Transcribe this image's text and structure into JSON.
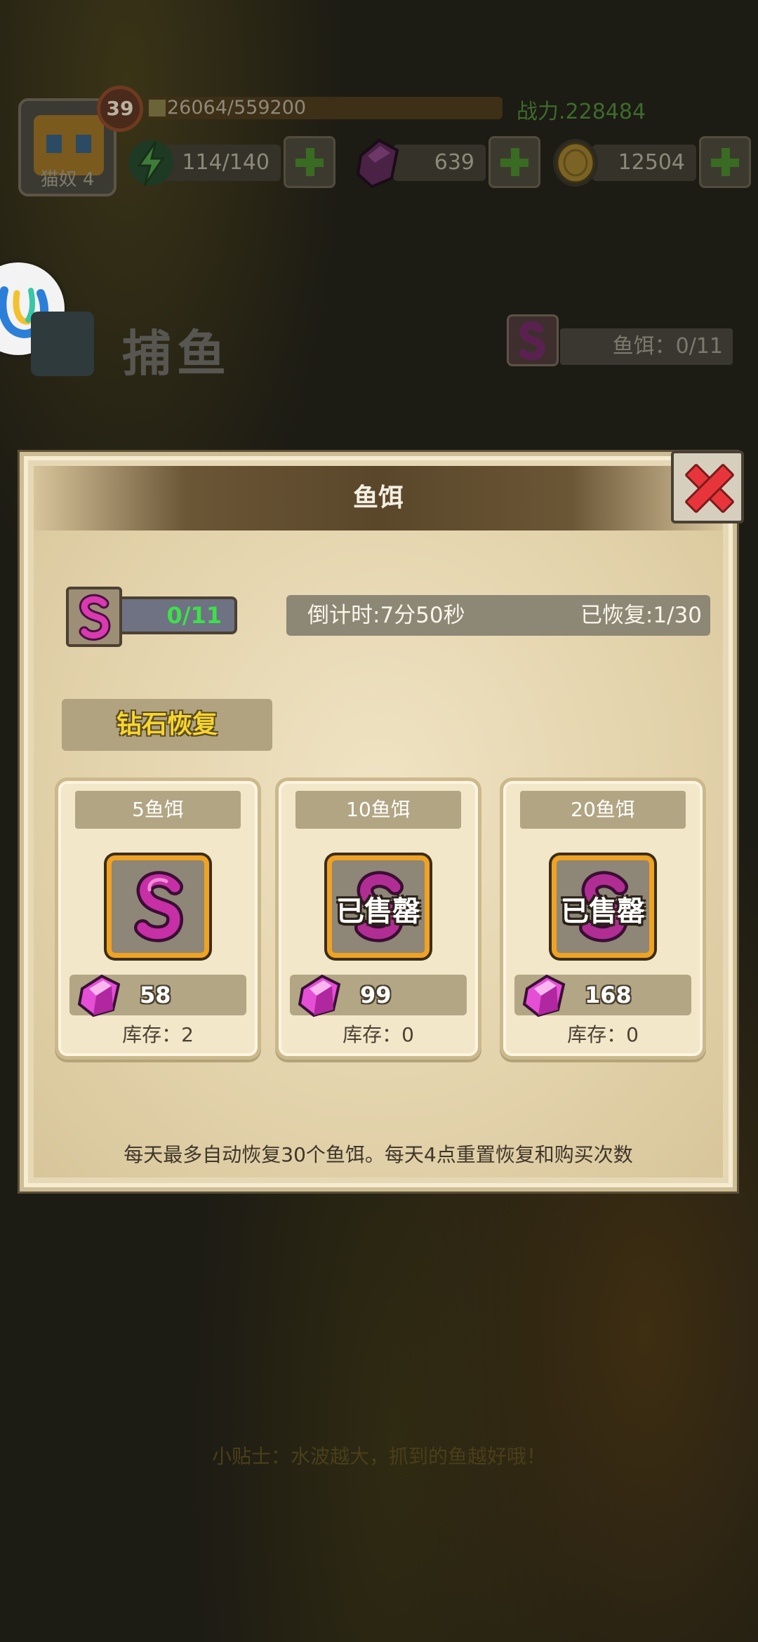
{
  "hud": {
    "player_name": "猫奴 4",
    "level": "39",
    "xp_text": "26064/559200",
    "xp_progress": 0.047,
    "power_text": "战力.228484",
    "energy": "114/140",
    "gems": "639",
    "coins": "12504"
  },
  "page": {
    "title": "捕鱼",
    "bait_counter": "鱼饵：0/11",
    "tip": "小贴士：水波越大，抓到的鱼越好哦！"
  },
  "dialog": {
    "title": "鱼饵",
    "bait_status": "0/11",
    "countdown": "倒计时:7分50秒",
    "recovered": "已恢复:1/30",
    "section_label": "钻石恢复",
    "footer": "每天最多自动恢复30个鱼饵。每天4点重置恢复和购买次数",
    "options": [
      {
        "title": "5鱼饵",
        "price": "58",
        "stock": "库存：2",
        "sold_out": false,
        "sold_out_text": ""
      },
      {
        "title": "10鱼饵",
        "price": "99",
        "stock": "库存：0",
        "sold_out": true,
        "sold_out_text": "已售罄"
      },
      {
        "title": "20鱼饵",
        "price": "168",
        "stock": "库存：0",
        "sold_out": true,
        "sold_out_text": "已售罄"
      }
    ]
  },
  "colors": {
    "bait_green": "#3ee04a",
    "section_yellow": "#f6d52e",
    "worm_pink": "#d93ab0",
    "gem_pink": "#e54fd6"
  },
  "icons": {
    "energy": "lightning-icon",
    "gem": "gem-icon",
    "coin": "coin-icon",
    "bait": "worm-icon",
    "close": "close-icon",
    "back": "back-icon"
  }
}
